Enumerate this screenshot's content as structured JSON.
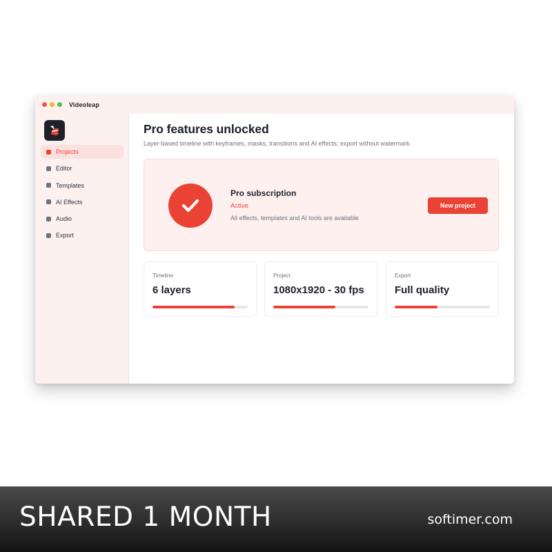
{
  "window": {
    "app_title": "Videoleap",
    "traffic_lights": [
      "close",
      "minimize",
      "maximize"
    ]
  },
  "sidebar": {
    "logo_icon": "videoleap-logo-icon",
    "items": [
      {
        "label": "Projects",
        "active": true
      },
      {
        "label": "Editor",
        "active": false
      },
      {
        "label": "Templates",
        "active": false
      },
      {
        "label": "AI Effects",
        "active": false
      },
      {
        "label": "Audio",
        "active": false
      },
      {
        "label": "Export",
        "active": false
      }
    ]
  },
  "main": {
    "title": "Pro features unlocked",
    "subtitle": "Layer-based timeline with keyframes, masks, transitions and AI effects; export without watermark.",
    "hero": {
      "icon": "check-circle-icon",
      "title": "Pro subscription",
      "status": "Active",
      "description": "All effects, templates and AI tools are available",
      "button_label": "New project"
    },
    "cards": [
      {
        "label": "Timeline",
        "value": "6 layers",
        "progress": 0.86
      },
      {
        "label": "Project",
        "value": "1080x1920 - 30 fps",
        "progress": 0.65
      },
      {
        "label": "Export",
        "value": "Full quality",
        "progress": 0.45
      }
    ]
  },
  "banner": {
    "left_text": "SHARED 1 MONTH",
    "right_text": "softimer.com"
  },
  "colors": {
    "accent": "#ea4335",
    "sidebar_bg": "#fdf1f0",
    "hero_bg": "#fdf0ef",
    "text_dark": "#1b1f2a",
    "text_muted": "#6b7280"
  }
}
